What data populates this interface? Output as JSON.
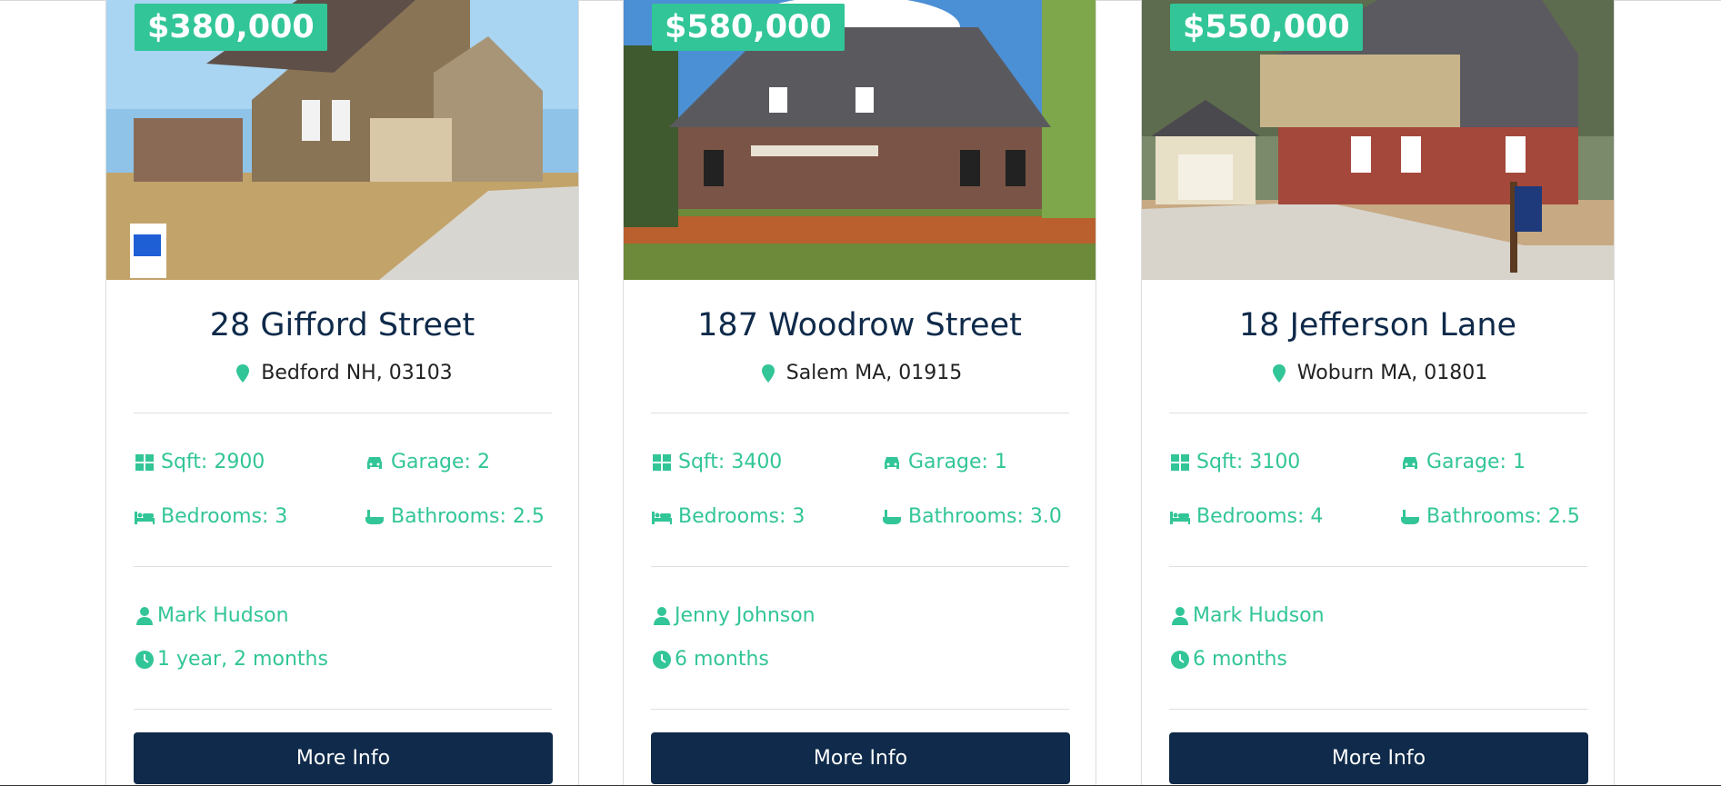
{
  "listings": [
    {
      "price": "$380,000",
      "address": "28 Gifford Street",
      "location": "Bedford NH, 03103",
      "sqft": "Sqft: 2900",
      "garage": "Garage: 2",
      "bedrooms": "Bedrooms: 3",
      "bathrooms": "Bathrooms: 2.5",
      "agent": "Mark Hudson",
      "listed": "1 year, 2 months",
      "button": "More Info"
    },
    {
      "price": "$580,000",
      "address": "187 Woodrow Street",
      "location": "Salem MA, 01915",
      "sqft": "Sqft: 3400",
      "garage": "Garage: 1",
      "bedrooms": "Bedrooms: 3",
      "bathrooms": "Bathrooms: 3.0",
      "agent": "Jenny Johnson",
      "listed": "6 months",
      "button": "More Info"
    },
    {
      "price": "$550,000",
      "address": "18 Jefferson Lane",
      "location": "Woburn MA, 01801",
      "sqft": "Sqft: 3100",
      "garage": "Garage: 1",
      "bedrooms": "Bedrooms: 4",
      "bathrooms": "Bathrooms: 2.5",
      "agent": "Mark Hudson",
      "listed": "6 months",
      "button": "More Info"
    }
  ],
  "colors": {
    "accent": "#32c597",
    "navy": "#0f2a4a"
  },
  "icons": [
    "map-marker-icon",
    "th-large-icon",
    "car-icon",
    "bed-icon",
    "bath-icon",
    "user-icon",
    "clock-icon"
  ]
}
